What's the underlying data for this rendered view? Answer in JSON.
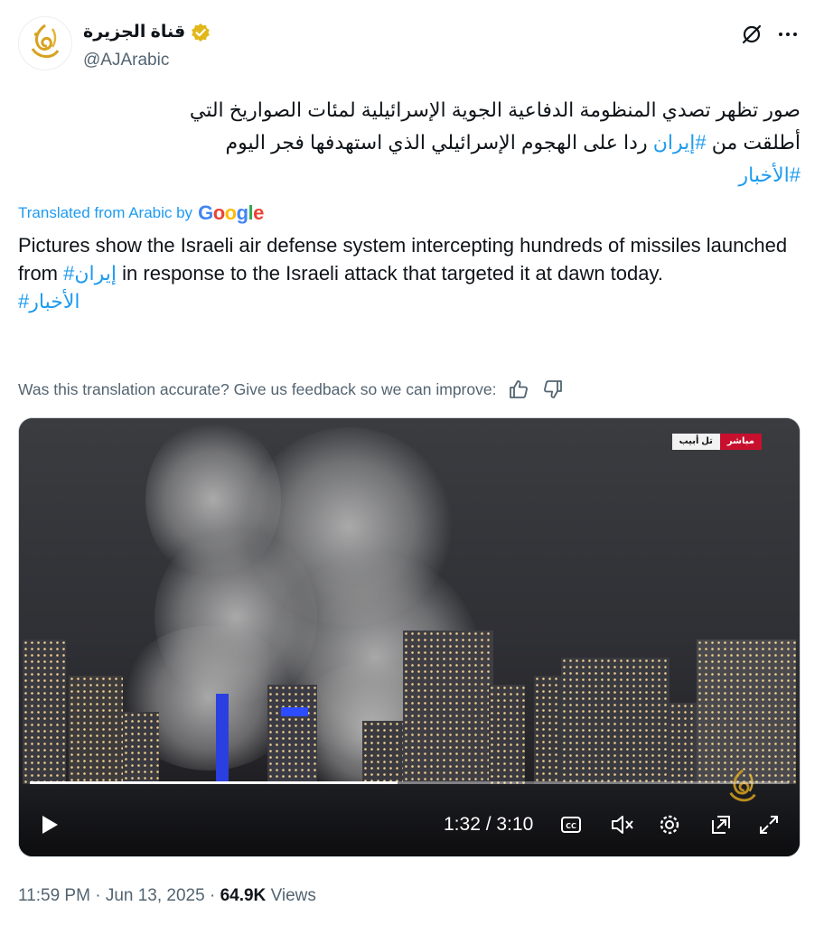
{
  "account": {
    "display_name": "قناة الجزيرة",
    "handle": "@AJArabic",
    "verified_icon": "verified-badge-icon"
  },
  "header_actions": {
    "grok_icon": "grok-icon",
    "more_icon": "more-icon"
  },
  "tweet": {
    "arabic_line1": "صور تظهر تصدي المنظومة الدفاعية الجوية الإسرائيلية لمئات الصواريخ التي",
    "arabic_line2_pre": "أطلقت من ",
    "arabic_hashtag1": "#إيران",
    "arabic_line2_post": " ردا على الهجوم الإسرائيلي الذي استهدفها فجر اليوم",
    "arabic_hashtag2": "#الأخبار"
  },
  "translation": {
    "label": "Translated from Arabic by",
    "provider": "Google",
    "text_pre": "Pictures show the Israeli air defense system intercepting hundreds of missiles launched from ",
    "hashtag1": "#إيران",
    "text_post": " in response to the Israeli attack that targeted it at dawn today.",
    "hashtag2": "#الأخبار",
    "feedback_prompt": "Was this translation accurate? Give us feedback so we can improve:"
  },
  "video": {
    "live_label": "مباشر",
    "location_label": "تل أبيب",
    "current_time": "1:32",
    "duration": "3:10",
    "time_display": "1:32 / 3:10",
    "progress": 0.484,
    "controls": {
      "play": "play-icon",
      "captions": "captions-icon",
      "mute": "volume-muted-icon",
      "settings": "settings-icon",
      "pip": "picture-in-picture-icon",
      "fullscreen": "fullscreen-icon"
    }
  },
  "meta": {
    "time": "11:59 PM",
    "date": "Jun 13, 2025",
    "views_count": "64.9K",
    "views_label": "Views"
  },
  "colors": {
    "link": "#1d9bf0",
    "secondary": "#536471",
    "verified": "#e2b719",
    "live_red": "#c8102e"
  }
}
